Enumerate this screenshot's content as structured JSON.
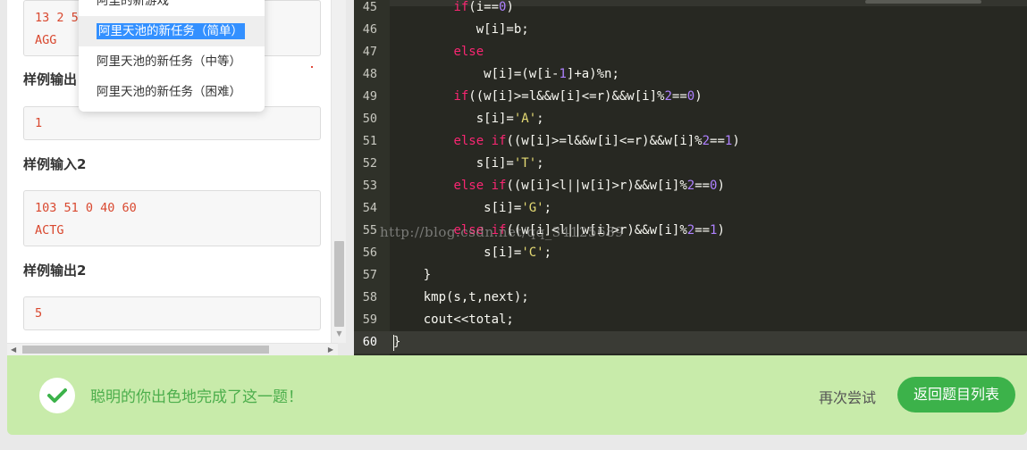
{
  "problem": {
    "sample_input_1_lines": [
      "13 2 5",
      "AGG"
    ],
    "heading_output_1": "样例输出",
    "sample_output_1_lines": [
      "1"
    ],
    "heading_input_2": "样例输入2",
    "sample_input_2_lines": [
      "103 51 0 40 60",
      "ACTG"
    ],
    "heading_output_2": "样例输出2",
    "sample_output_2_lines": [
      "5"
    ]
  },
  "dropdown": {
    "items": [
      {
        "label": "阿里的新游戏"
      },
      {
        "label": "阿里天池的新任务（简单）",
        "selected": true
      },
      {
        "label": "阿里天池的新任务（中等）"
      },
      {
        "label": "阿里天池的新任务（困难）"
      }
    ]
  },
  "editor": {
    "active_line": 60,
    "lines": [
      {
        "n": "45",
        "indent": "        ",
        "tokens": [
          [
            "kw",
            "if"
          ],
          [
            "",
            "(i=="
          ],
          [
            "num",
            "0"
          ],
          [
            "",
            ")"
          ]
        ]
      },
      {
        "n": "46",
        "indent": "           ",
        "tokens": [
          [
            "",
            "w[i]=b;"
          ]
        ]
      },
      {
        "n": "47",
        "indent": "        ",
        "tokens": [
          [
            "kw",
            "else"
          ]
        ]
      },
      {
        "n": "48",
        "indent": "            ",
        "tokens": [
          [
            "",
            "w[i]=(w[i-"
          ],
          [
            "num",
            "1"
          ],
          [
            "",
            "]+a)%n;"
          ]
        ]
      },
      {
        "n": "49",
        "indent": "        ",
        "tokens": [
          [
            "kw",
            "if"
          ],
          [
            "",
            "((w[i]>=l&&w[i]<=r)&&w[i]%"
          ],
          [
            "num",
            "2"
          ],
          [
            "",
            "=="
          ],
          [
            "num",
            "0"
          ],
          [
            "",
            ")"
          ]
        ]
      },
      {
        "n": "50",
        "indent": "           ",
        "tokens": [
          [
            "",
            "s[i]="
          ],
          [
            "str",
            "'A'"
          ],
          [
            "",
            ";"
          ]
        ]
      },
      {
        "n": "51",
        "indent": "        ",
        "tokens": [
          [
            "kw",
            "else if"
          ],
          [
            "",
            "((w[i]>=l&&w[i]<=r)&&w[i]%"
          ],
          [
            "num",
            "2"
          ],
          [
            "",
            "=="
          ],
          [
            "num",
            "1"
          ],
          [
            "",
            ")"
          ]
        ]
      },
      {
        "n": "52",
        "indent": "           ",
        "tokens": [
          [
            "",
            "s[i]="
          ],
          [
            "str",
            "'T'"
          ],
          [
            "",
            ";"
          ]
        ]
      },
      {
        "n": "53",
        "indent": "        ",
        "tokens": [
          [
            "kw",
            "else if"
          ],
          [
            "",
            "((w[i]<l||w[i]>r)&&w[i]%"
          ],
          [
            "num",
            "2"
          ],
          [
            "",
            "=="
          ],
          [
            "num",
            "0"
          ],
          [
            "",
            ")"
          ]
        ]
      },
      {
        "n": "54",
        "indent": "            ",
        "tokens": [
          [
            "",
            "s[i]="
          ],
          [
            "str",
            "'G'"
          ],
          [
            "",
            ";"
          ]
        ]
      },
      {
        "n": "55",
        "indent": "        ",
        "tokens": [
          [
            "kw",
            "else if"
          ],
          [
            "",
            "((w[i]<l||w[i]>r)&&w[i]%"
          ],
          [
            "num",
            "2"
          ],
          [
            "",
            "=="
          ],
          [
            "num",
            "1"
          ],
          [
            "",
            ")"
          ]
        ]
      },
      {
        "n": "56",
        "indent": "            ",
        "tokens": [
          [
            "",
            "s[i]="
          ],
          [
            "str",
            "'C'"
          ],
          [
            "",
            ";"
          ]
        ]
      },
      {
        "n": "57",
        "indent": "    ",
        "tokens": [
          [
            "",
            "}"
          ]
        ]
      },
      {
        "n": "58",
        "indent": "    ",
        "tokens": [
          [
            "",
            "kmp(s,t,next);"
          ]
        ]
      },
      {
        "n": "59",
        "indent": "    ",
        "tokens": [
          [
            "",
            "cout<<total;"
          ]
        ]
      },
      {
        "n": "60",
        "indent": "",
        "tokens": [
          [
            "",
            "}"
          ]
        ]
      }
    ],
    "watermark": "http://blog.csdn.net/qq_34125689"
  },
  "result": {
    "message": "聪明的你出色地完成了这一题！",
    "retry_label": "再次尝试",
    "back_label": "返回题目列表",
    "colors": {
      "bar": "#c8ebaa",
      "message": "#4cae4c",
      "button": "#3cb24a"
    }
  },
  "icons": {
    "check": "check-icon"
  }
}
